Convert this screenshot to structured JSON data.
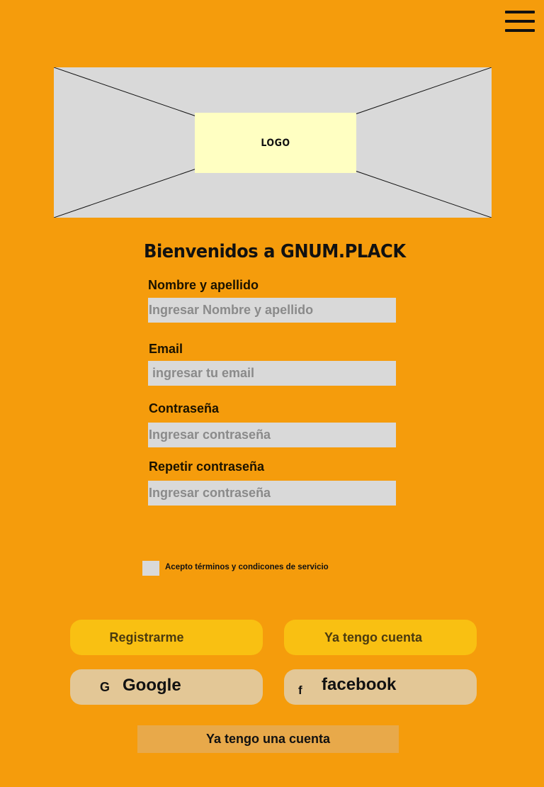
{
  "header": {
    "menu_icon": "hamburger-menu-icon"
  },
  "banner": {
    "logo_text": "LOGO"
  },
  "form": {
    "title": "Bienvenidos a GNUM.PLACK",
    "fields": [
      {
        "label": "Nombre y apellido",
        "placeholder": "Ingresar Nombre y apellido",
        "value": ""
      },
      {
        "label": "Email",
        "placeholder": " ingresar tu email",
        "value": ""
      },
      {
        "label": "Contraseña",
        "placeholder": "Ingresar contraseña",
        "value": ""
      },
      {
        "label": "Repetir contraseña",
        "placeholder": "Ingresar contraseña",
        "value": ""
      }
    ],
    "terms_label": "Acepto términos y condicones de servicio",
    "terms_checked": false
  },
  "buttons": {
    "register": "Registrarme",
    "have_account": "Ya tengo cuenta",
    "google": "Google",
    "google_icon": "G",
    "facebook": "facebook",
    "facebook_icon": "f",
    "have_an_account": "Ya tengo una cuenta"
  },
  "colors": {
    "background": "#f59c0c",
    "input": "#d9d9d9",
    "primary_button": "#f9c012",
    "social_button": "#e3c796",
    "secondary_button": "#e8a94a",
    "logo_box": "#ffffc2"
  }
}
